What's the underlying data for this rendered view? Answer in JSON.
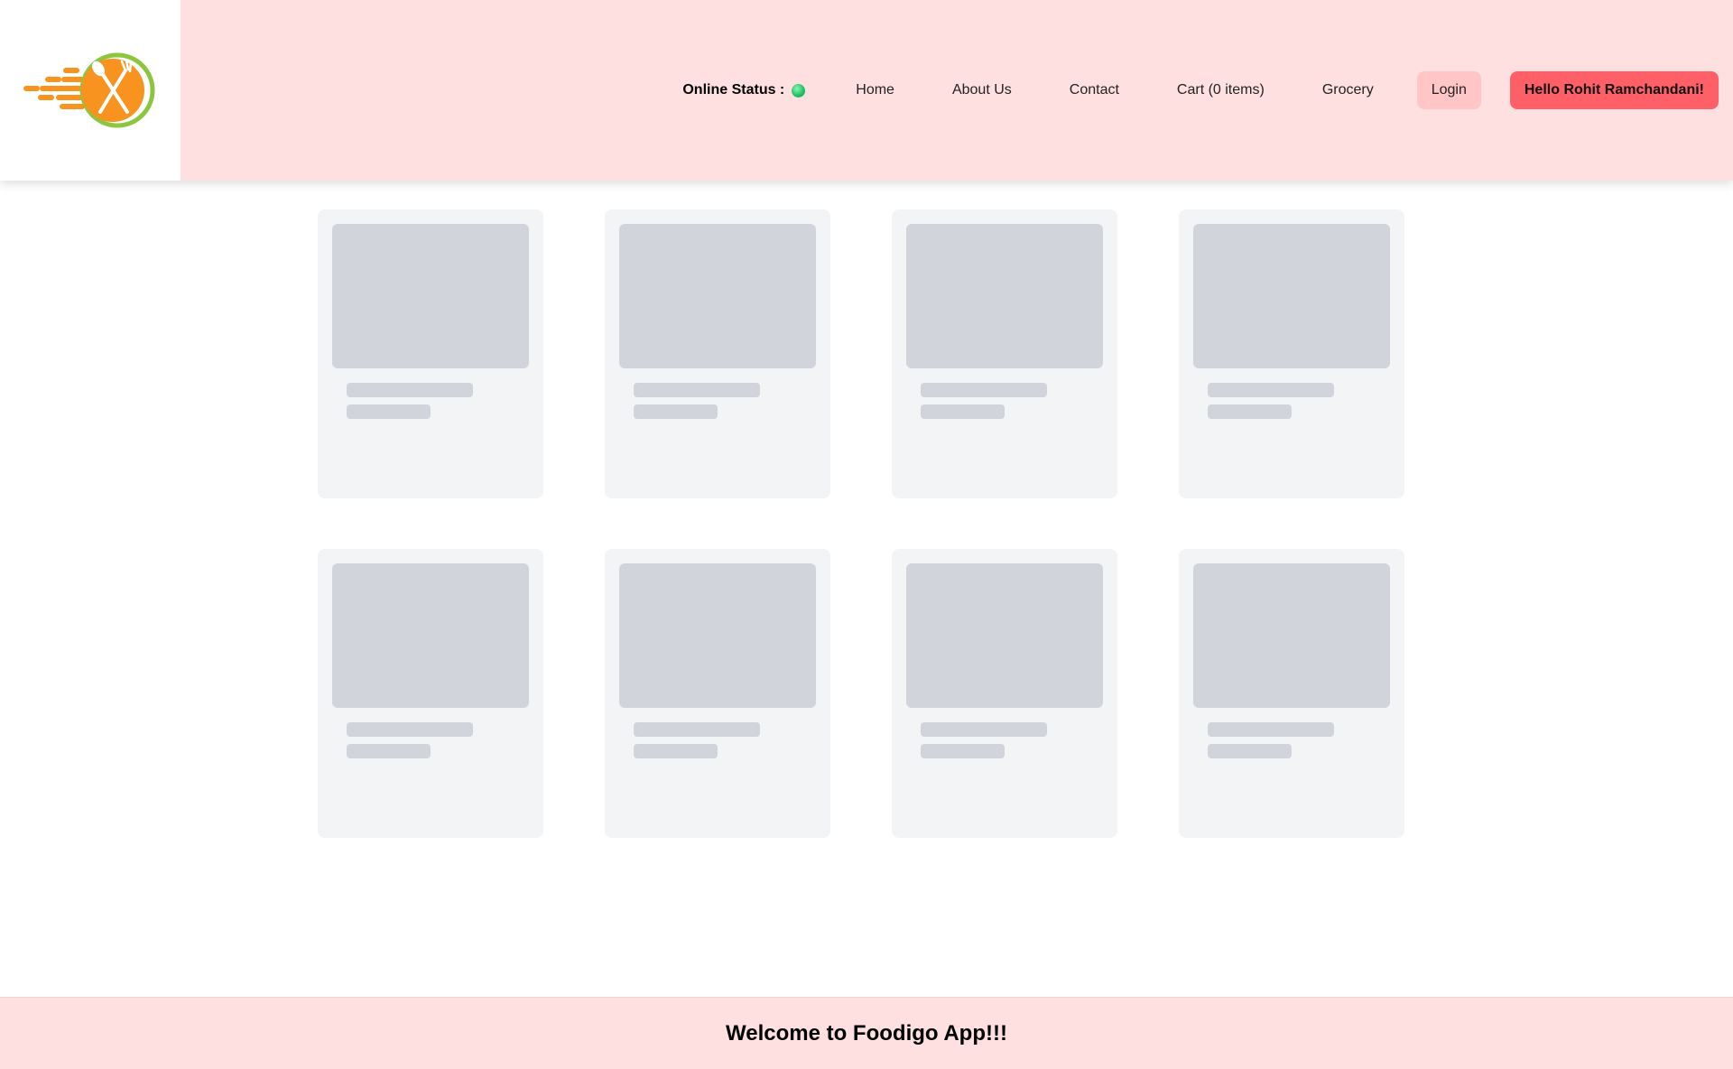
{
  "header": {
    "logo_icon": "foodigo-logo-fork-spoon",
    "online_status": {
      "label": "Online Status :",
      "indicator_color": "#22c463"
    },
    "nav": [
      {
        "label": "Home"
      },
      {
        "label": "About Us"
      },
      {
        "label": "Contact"
      },
      {
        "label": "Cart (0 items)"
      },
      {
        "label": "Grocery"
      }
    ],
    "login_label": "Login",
    "user_label": "Hello Rohit Ramchandani!"
  },
  "colors": {
    "header_bg": "#ffe0e1",
    "login_bg": "#ffc5c7",
    "user_button_bg": "#ff5f66",
    "shimmer_card": "#f3f4f6",
    "shimmer_block": "#d1d5db"
  },
  "shimmer_cards": [
    {
      "id": 1
    },
    {
      "id": 2
    },
    {
      "id": 3
    },
    {
      "id": 4
    },
    {
      "id": 5
    },
    {
      "id": 6
    },
    {
      "id": 7
    },
    {
      "id": 8
    }
  ],
  "footer": {
    "text": "Welcome to Foodigo App!!!"
  }
}
